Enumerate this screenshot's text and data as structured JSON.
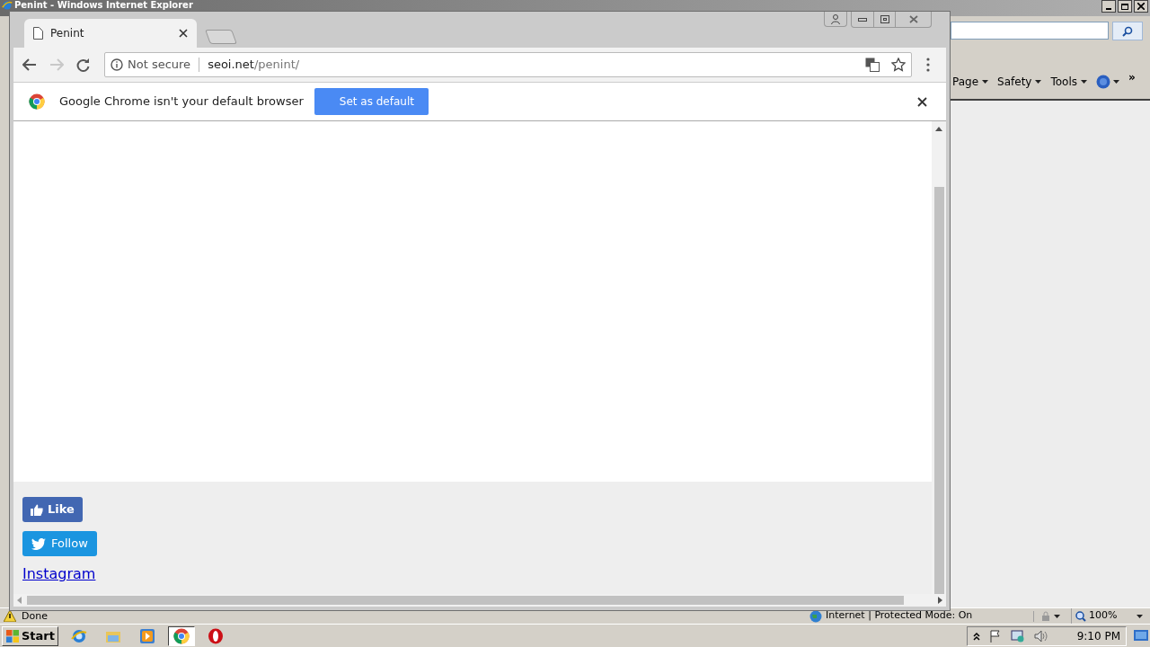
{
  "ie_window": {
    "title": "Penint - Windows Internet Explorer",
    "command_bar": [
      {
        "label": "Page"
      },
      {
        "label": "Safety"
      },
      {
        "label": "Tools"
      }
    ],
    "overflow": "»",
    "status": {
      "text": "Done",
      "zone": "Internet | Protected Mode: On",
      "zoom": "100%"
    }
  },
  "chrome_window": {
    "tabs": [
      {
        "title": "Penint",
        "selected": true
      }
    ],
    "address": {
      "security": "Not secure",
      "host": "seoi.net",
      "path": "/penint/"
    },
    "infobar": {
      "message": "Google Chrome isn't your default browser",
      "button": "Set as default"
    },
    "page": {
      "like": "Like",
      "follow": "Follow",
      "link": "Instagram"
    }
  },
  "taskbar": {
    "start": "Start",
    "apps": [
      {
        "kind": "ie",
        "selected": false
      },
      {
        "kind": "folder",
        "selected": false
      },
      {
        "kind": "media",
        "selected": false
      },
      {
        "kind": "chrome",
        "selected": true
      },
      {
        "kind": "opera",
        "selected": false
      }
    ],
    "clock": "9:10 PM"
  }
}
